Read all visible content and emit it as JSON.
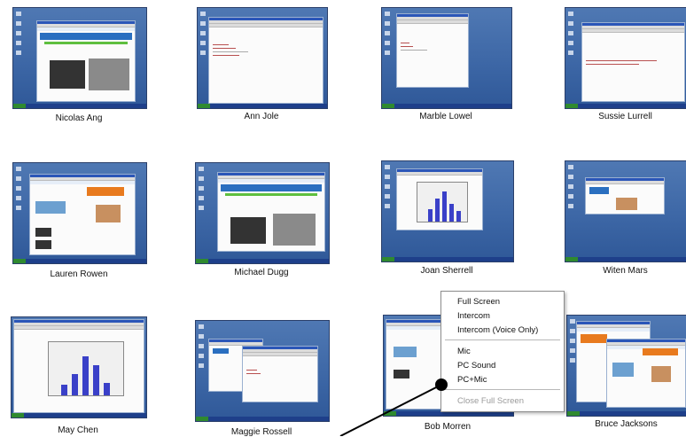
{
  "students": [
    {
      "name": "Nicolas Ang"
    },
    {
      "name": "Ann Jole"
    },
    {
      "name": "Marble Lowel"
    },
    {
      "name": "Sussie Lurrell"
    },
    {
      "name": "Lauren Rowen"
    },
    {
      "name": "Michael Dugg"
    },
    {
      "name": "Joan Sherrell"
    },
    {
      "name": "Witen Mars"
    },
    {
      "name": "May Chen"
    },
    {
      "name": "Maggie Rossell"
    },
    {
      "name": "Bob Morren"
    },
    {
      "name": "Bruce Jacksons"
    }
  ],
  "context_menu": {
    "items": [
      {
        "label": "Full Screen",
        "enabled": true
      },
      {
        "label": "Intercom",
        "enabled": true
      },
      {
        "label": "Intercom (Voice Only)",
        "enabled": true
      },
      {
        "label": "Mic",
        "enabled": true
      },
      {
        "label": "PC Sound",
        "enabled": true
      },
      {
        "label": "PC+Mic",
        "enabled": true
      },
      {
        "label": "Close Full Screen",
        "enabled": false
      }
    ]
  },
  "colors": {
    "desktop": "#3d67a6",
    "menu_bg": "#ffffff",
    "disabled_text": "#9a9a9a"
  }
}
